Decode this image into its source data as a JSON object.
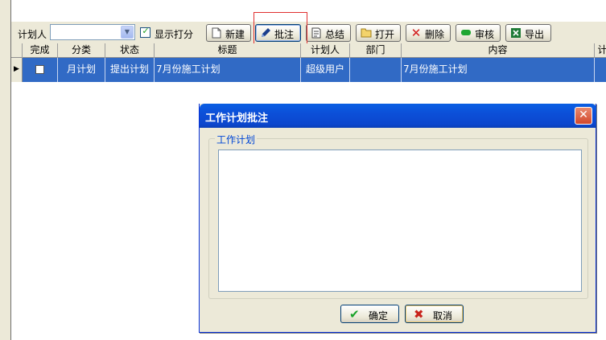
{
  "toolbar": {
    "planner_label": "计划人",
    "planner_value": "",
    "show_score_label": "显示打分",
    "show_score_checked": true,
    "buttons": {
      "new": "新建",
      "annotate": "批注",
      "summary": "总结",
      "open": "打开",
      "delete": "删除",
      "review": "审核",
      "export": "导出"
    },
    "icons": {
      "new": "new-document-icon",
      "annotate": "pen-icon",
      "summary": "summary-document-icon",
      "open": "open-folder-icon",
      "delete": "delete-x-icon",
      "review": "review-green-icon",
      "export": "excel-export-icon"
    }
  },
  "grid": {
    "columns": [
      "完成",
      "分类",
      "状态",
      "标题",
      "计划人",
      "部门",
      "内容",
      "计"
    ],
    "rows": [
      {
        "done": false,
        "category": "月计划",
        "status": "提出计划",
        "title": "7月份施工计划",
        "planner": "超级用户",
        "department": "",
        "content": "7月份施工计划"
      }
    ],
    "selected_row_color": "#316ac5"
  },
  "dialog": {
    "title": "工作计划批注",
    "group_label": "工作计划",
    "memo_text": "",
    "ok_label": "确定",
    "cancel_label": "取消"
  },
  "colors": {
    "accent": "#0a5fe4",
    "highlight_frame": "#e03030"
  }
}
